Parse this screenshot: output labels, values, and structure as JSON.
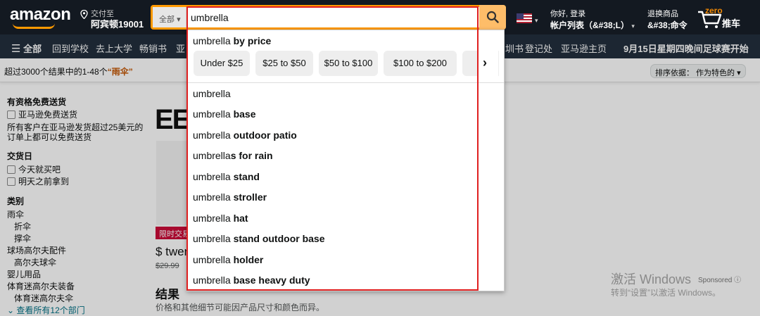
{
  "header": {
    "logo": "amazon",
    "deliver_line1": "交付至",
    "deliver_line2": "阿宾顿19001",
    "search_category": "全部",
    "search_value": "umbrella",
    "account_line1": "你好, 登录",
    "account_line2": "帐户列表（&#38;L）",
    "returns_line1": "退换商品",
    "returns_line2": "&#38;命令",
    "cart_count": "zero",
    "cart_label": "推车"
  },
  "subnav": {
    "all": "全部",
    "items": [
      "回到学校",
      "去上大学",
      "畅销书",
      "亚"
    ],
    "right_items": [
      "圳书",
      "登记处",
      "亚马逊主页"
    ],
    "promo": "9月15日星期四晚间足球赛开始"
  },
  "results": {
    "text_prefix": "超过3000个结果中的1-48个",
    "query": "“雨伞”",
    "sort_label": "排序依据：  作为特色的"
  },
  "sidebar": {
    "free_ship_heading": "有资格免费送货",
    "free_ship_option": "亚马逊免费送货",
    "free_ship_note1": "所有客户在亚马逊发货超过25美元的",
    "free_ship_note2": "订单上都可以免费送货",
    "delivery_heading": "交货日",
    "delivery_opt1": "今天就买吧",
    "delivery_opt2": "明天之前拿到",
    "category_heading": "类别",
    "categories": [
      "雨伞",
      "折伞",
      "撑伞",
      "球场高尔夫配件",
      "高尔夫球伞",
      "婴儿用品",
      "体育迷高尔夫装备",
      "体育迷高尔夫伞"
    ],
    "see_all": "查看所有12个部门"
  },
  "main": {
    "big_text": "EE",
    "deal_badge": "限时交易",
    "product_title": "$ twen",
    "product_price": "$29.99",
    "results_heading": "结果",
    "results_sub": "价格和其他细节可能因产品尺寸和颜色而异。"
  },
  "dropdown": {
    "section_prefix": "umbrella",
    "section_bold": " by price",
    "chips": [
      "Under $25",
      "$25 to $50",
      "$50 to $100",
      "$100 to $200"
    ],
    "suggestions": [
      {
        "plain": "umbrella",
        "bold": ""
      },
      {
        "plain": "umbrella",
        "bold": " base"
      },
      {
        "plain": "umbrella",
        "bold": " outdoor patio"
      },
      {
        "plain": "umbrella",
        "bold": "s for rain"
      },
      {
        "plain": "umbrella",
        "bold": " stand"
      },
      {
        "plain": "umbrella",
        "bold": " stroller"
      },
      {
        "plain": "umbrella",
        "bold": " hat"
      },
      {
        "plain": "umbrella",
        "bold": " stand outdoor base"
      },
      {
        "plain": "umbrella",
        "bold": " holder"
      },
      {
        "plain": "umbrella",
        "bold": " base heavy duty"
      }
    ]
  },
  "watermark": {
    "line1": "激活 Windows",
    "line2": "转到“设置”以激活 Windows。",
    "sponsored": "Sponsored"
  },
  "colors": {
    "nav_bg": "#131921",
    "subnav_bg": "#232f3e",
    "accent": "#ff9900",
    "search_button": "#febd69",
    "highlight_box": "#e02020"
  }
}
